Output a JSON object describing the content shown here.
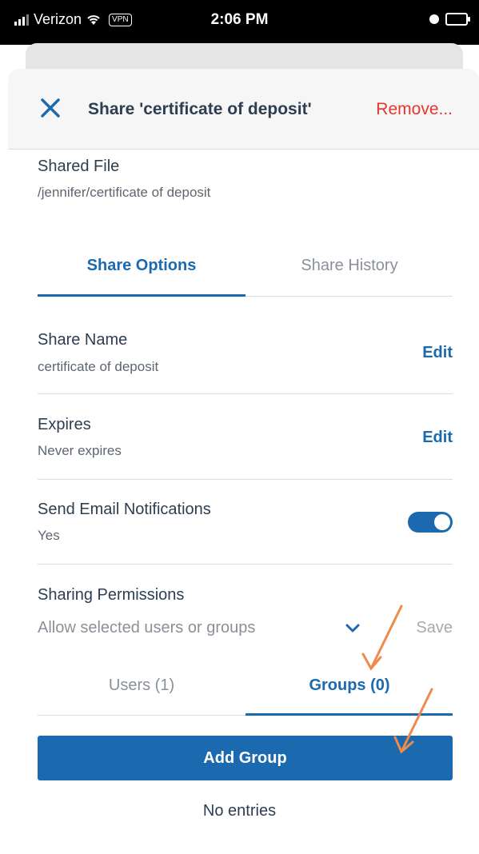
{
  "status_bar": {
    "carrier": "Verizon",
    "vpn": "VPN",
    "time": "2:06 PM"
  },
  "header": {
    "title": "Share 'certificate of deposit'",
    "remove": "Remove..."
  },
  "shared_file": {
    "label": "Shared File",
    "path": "/jennifer/certificate of deposit"
  },
  "tabs": {
    "options": "Share Options",
    "history": "Share History"
  },
  "share_name": {
    "label": "Share Name",
    "value": "certificate of deposit",
    "action": "Edit"
  },
  "expires": {
    "label": "Expires",
    "value": "Never expires",
    "action": "Edit"
  },
  "email": {
    "label": "Send Email Notifications",
    "value": "Yes",
    "toggle_on": true
  },
  "permissions": {
    "label": "Sharing Permissions",
    "selected": "Allow selected users or groups",
    "save": "Save"
  },
  "subtabs": {
    "users": "Users (1)",
    "groups": "Groups (0)"
  },
  "add_group": "Add Group",
  "empty": "No entries",
  "colors": {
    "accent": "#1b6aaf",
    "danger": "#e8352b",
    "annotation": "#f08a4b"
  }
}
